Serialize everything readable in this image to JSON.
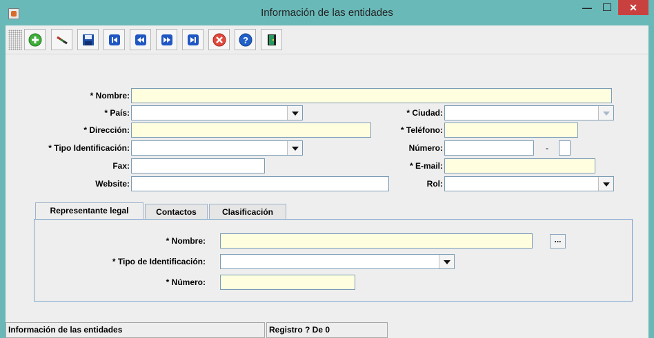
{
  "window": {
    "title": "Información de las entidades"
  },
  "toolbar": {
    "buttons": [
      {
        "icon": "add-icon"
      },
      {
        "icon": "edit-icon"
      },
      {
        "icon": "save-icon"
      },
      {
        "icon": "first-record-icon"
      },
      {
        "icon": "previous-record-icon"
      },
      {
        "icon": "next-record-icon"
      },
      {
        "icon": "last-record-icon"
      },
      {
        "icon": "cancel-icon"
      },
      {
        "icon": "help-icon"
      },
      {
        "icon": "exit-door-icon"
      }
    ]
  },
  "form": {
    "nombre_label": "* Nombre:",
    "pais_label": "* País:",
    "ciudad_label": "* Ciudad:",
    "direccion_label": "* Dirección:",
    "telefono_label": "* Teléfono:",
    "tipo_identificacion_label": "* Tipo Identificación:",
    "numero_label": "Número:",
    "numero_separator": "-",
    "fax_label": "Fax:",
    "email_label": "* E-mail:",
    "website_label": "Website:",
    "rol_label": "Rol:"
  },
  "tabs": [
    {
      "label": "Representante legal",
      "active": true
    },
    {
      "label": "Contactos",
      "active": false
    },
    {
      "label": "Clasificación",
      "active": false
    }
  ],
  "representante": {
    "nombre_label": "* Nombre:",
    "ellipsis_label": "...",
    "tipo_label": "* Tipo de Identificación:",
    "numero_label": "* Número:"
  },
  "status": {
    "text": "Información de las entidades",
    "record": "Registro ? De 0"
  },
  "colors": {
    "title_bar": "#6ab9b9",
    "required_field": "#ffffe0",
    "close_button": "#c9413f"
  }
}
